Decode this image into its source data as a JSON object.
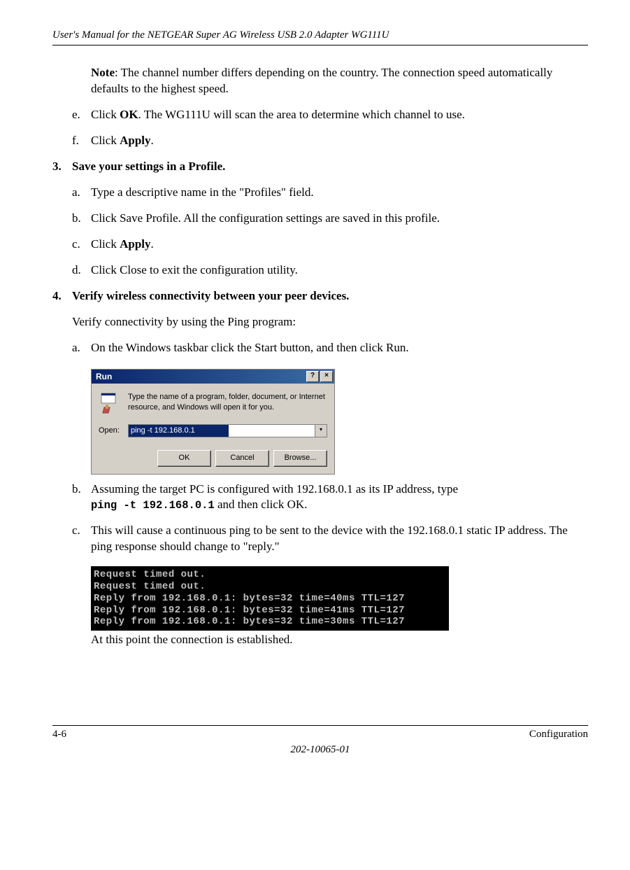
{
  "header": "User's Manual for the NETGEAR Super AG Wireless USB 2.0 Adapter WG111U",
  "note_label": "Note",
  "note_text": ": The channel number differs depending on the country. The connection speed automatically defaults to the highest speed.",
  "step_e_letter": "e.",
  "step_e_pre": "Click ",
  "step_e_bold": "OK",
  "step_e_post": ". The WG111U will scan the area to determine which channel to use.",
  "step_f_letter": "f.",
  "step_f_pre": "Click ",
  "step_f_bold": "Apply",
  "step_f_post": ".",
  "step3_num": "3.",
  "step3_text": "Save your settings in a Profile.",
  "s3a_letter": "a.",
  "s3a_text": "Type a descriptive name in the \"Profiles\" field.",
  "s3b_letter": "b.",
  "s3b_text": "Click Save Profile. All the configuration settings are saved in this profile.",
  "s3c_letter": "c.",
  "s3c_pre": "Click ",
  "s3c_bold": "Apply",
  "s3c_post": ".",
  "s3d_letter": "d.",
  "s3d_text": "Click Close to exit the configuration utility.",
  "step4_num": "4.",
  "step4_text": "Verify wireless connectivity between your peer devices.",
  "step4_intro": "Verify connectivity by using the Ping program:",
  "s4a_letter": "a.",
  "s4a_text": "On the Windows taskbar click the Start button, and then click Run.",
  "run_dialog": {
    "title": "Run",
    "help": "?",
    "close": "×",
    "desc": "Type the name of a program, folder, document, or Internet resource, and Windows will open it for you.",
    "open_label": "Open:",
    "input_value": "ping -t 192.168.0.1",
    "dd": "▾",
    "ok": "OK",
    "cancel": "Cancel",
    "browse": "Browse..."
  },
  "s4b_letter": "b.",
  "s4b_pre": "Assuming the target PC is configured with 192.168.0.1 as its IP address, type ",
  "s4b_mono": "ping -t 192.168.0.1",
  "s4b_post": " and then click OK.",
  "s4c_letter": "c.",
  "s4c_text": "This will cause a continuous ping to be sent to the device with the 192.168.0.1 static IP address. The ping response should change to \"reply.\"",
  "terminal": "Request timed out.\nRequest timed out.\nReply from 192.168.0.1: bytes=32 time=40ms TTL=127\nReply from 192.168.0.1: bytes=32 time=41ms TTL=127\nReply from 192.168.0.1: bytes=32 time=30ms TTL=127",
  "after_terminal": "At this point the connection is established.",
  "footer_left": "4-6",
  "footer_right": "Configuration",
  "footer_center": "202-10065-01"
}
